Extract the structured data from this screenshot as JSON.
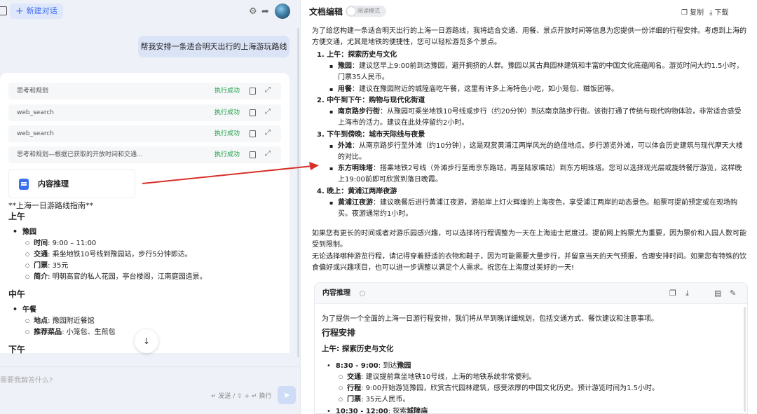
{
  "left": {
    "new_chat": "新建对话",
    "user_message": "帮我安排一条适合明天出行的上海游玩路线",
    "steps": [
      {
        "name": "思考和规划",
        "status": "执行成功"
      },
      {
        "name": "web_search",
        "status": "执行成功"
      },
      {
        "name": "web_search",
        "status": "执行成功"
      },
      {
        "name": "思考和规划—根据已获取的开放时间和交通...",
        "status": "执行成功"
      }
    ],
    "content_card": "内容推理",
    "guide_title": "**上海一日游路线指南**",
    "sections": [
      {
        "heading": "上午",
        "place": "豫园",
        "details": [
          {
            "k": "时间",
            "v": ": 9:00 – 11:00"
          },
          {
            "k": "交通",
            "v": ": 乘坐地铁10号线到豫园站，步行5分钟即达。"
          },
          {
            "k": "门票",
            "v": ": 35元"
          },
          {
            "k": "简介",
            "v": ": 明朝高官的私人花园，亭台楼阁，江南庭园造景。"
          }
        ]
      },
      {
        "heading": "中午",
        "place": "午餐",
        "details": [
          {
            "k": "地点",
            "v": ": 豫园附近餐馆"
          },
          {
            "k": "推荐菜品",
            "v": ": 小笼包、生煎包"
          }
        ]
      }
    ],
    "next_heading": "下午",
    "input_placeholder": "需要我解答什么?",
    "input_hint": "↵ 发送 / ⇧ + ↵ 换行"
  },
  "right": {
    "title": "文档编辑",
    "reading_mode": "阅读模式",
    "copy": "复制",
    "download": "下载",
    "intro": "为了给您构建一条适合明天出行的上海一日游路线，我将结合交通、用餐、景点开放时间等信息为您提供一份详细的行程安排。考虑到上海的方便交通，尤其是地铁的便捷性，您可以轻松游览多个景点。",
    "plan": [
      {
        "title": "1. 上午：探索历史与文化",
        "items": [
          {
            "k": "豫园",
            "v": "：建议您早上9:00前到达豫园，避开拥挤的人群。豫园以其古典园林建筑和丰富的中国文化底蕴闻名。游览时间大约1.5小时，门票35人民币。"
          },
          {
            "k": "用餐",
            "v": "：建议在豫园附近的城隍庙吃午餐，这里有许多上海特色小吃，如小笼包、糍饭团等。"
          }
        ]
      },
      {
        "title": "2. 中午到下午：购物与现代化街道",
        "items": [
          {
            "k": "南京路步行街",
            "v": "：从豫园可乘坐地铁10号线或步行（约20分钟）到达南京路步行街。该街打通了传统与现代购物体验，非常适合感受上海市的活力。建议在此处停留约2小时。"
          }
        ]
      },
      {
        "title": "3. 下午到傍晚：城市天际线与夜景",
        "items": [
          {
            "k": "外滩",
            "v": "：从南京路步行至外滩（约10分钟），这是观赏黄浦江两岸风光的绝佳地点。步行游览外滩，可以体会历史建筑与现代摩天大楼的对比。"
          },
          {
            "k": "东方明珠塔",
            "v": "：搭乘地铁2号线（外滩步行至南京东路站，再至陆家嘴站）到东方明珠塔。您可以选择观光层或旋转餐厅游览，这样晚上19:00前即可欣赏到落日晚霞。"
          }
        ]
      },
      {
        "title": "4. 晚上：黄浦江两岸夜游",
        "items": [
          {
            "k": "黄浦江夜游",
            "v": "：建议晚餐后进行黄浦江夜游，游船岸上灯火辉煌的上海夜色，享受浦江两岸的动态景色。船票可提前预定或在现场购买。夜游通常约1小时。"
          }
        ]
      }
    ],
    "outro1": "如果您有更长的时间或者对游乐园感兴趣，可以选择将行程调整为一天在上海迪士尼度过。提前网上购票尤为重要，因为票价和入园人数可能受到限制。",
    "outro2": "无论选择哪种游览行程，请记得穿着舒适的衣物和鞋子，因为可能需要大量步行，并留意当天的天气预报，合理安排时间。如果您有特殊的饮食偏好或兴趣项目，也可以进一步调整以满足个人需求。祝您在上海度过美好的一天!",
    "lower_card": {
      "title": "内容推理",
      "intro": "为了提供一个全面的上海一日游行程安排，我们将从早到晚详细规划，包括交通方式、餐饮建议和注意事项。",
      "h2": "行程安排",
      "h3": "上午: 探索历史与文化",
      "b1_time": "8:30 - 9:00",
      "b1_rest": ": 到达",
      "b1_place": "豫园",
      "b1_subs": [
        {
          "k": "交通",
          "v": ": 建议提前乘坐地铁10号线，上海的地铁系统非常便利。"
        },
        {
          "k": "行程",
          "v": ": 9:00开始游览豫园，欣赏古代园林建筑，感受浓厚的中国文化历史。预计游览时间为1.5小时。"
        },
        {
          "k": "门票",
          "v": ": 35元人民币。"
        }
      ],
      "b2_time": "10:30 - 12:00",
      "b2_rest": ": 探索",
      "b2_place": "城隍庙"
    }
  }
}
